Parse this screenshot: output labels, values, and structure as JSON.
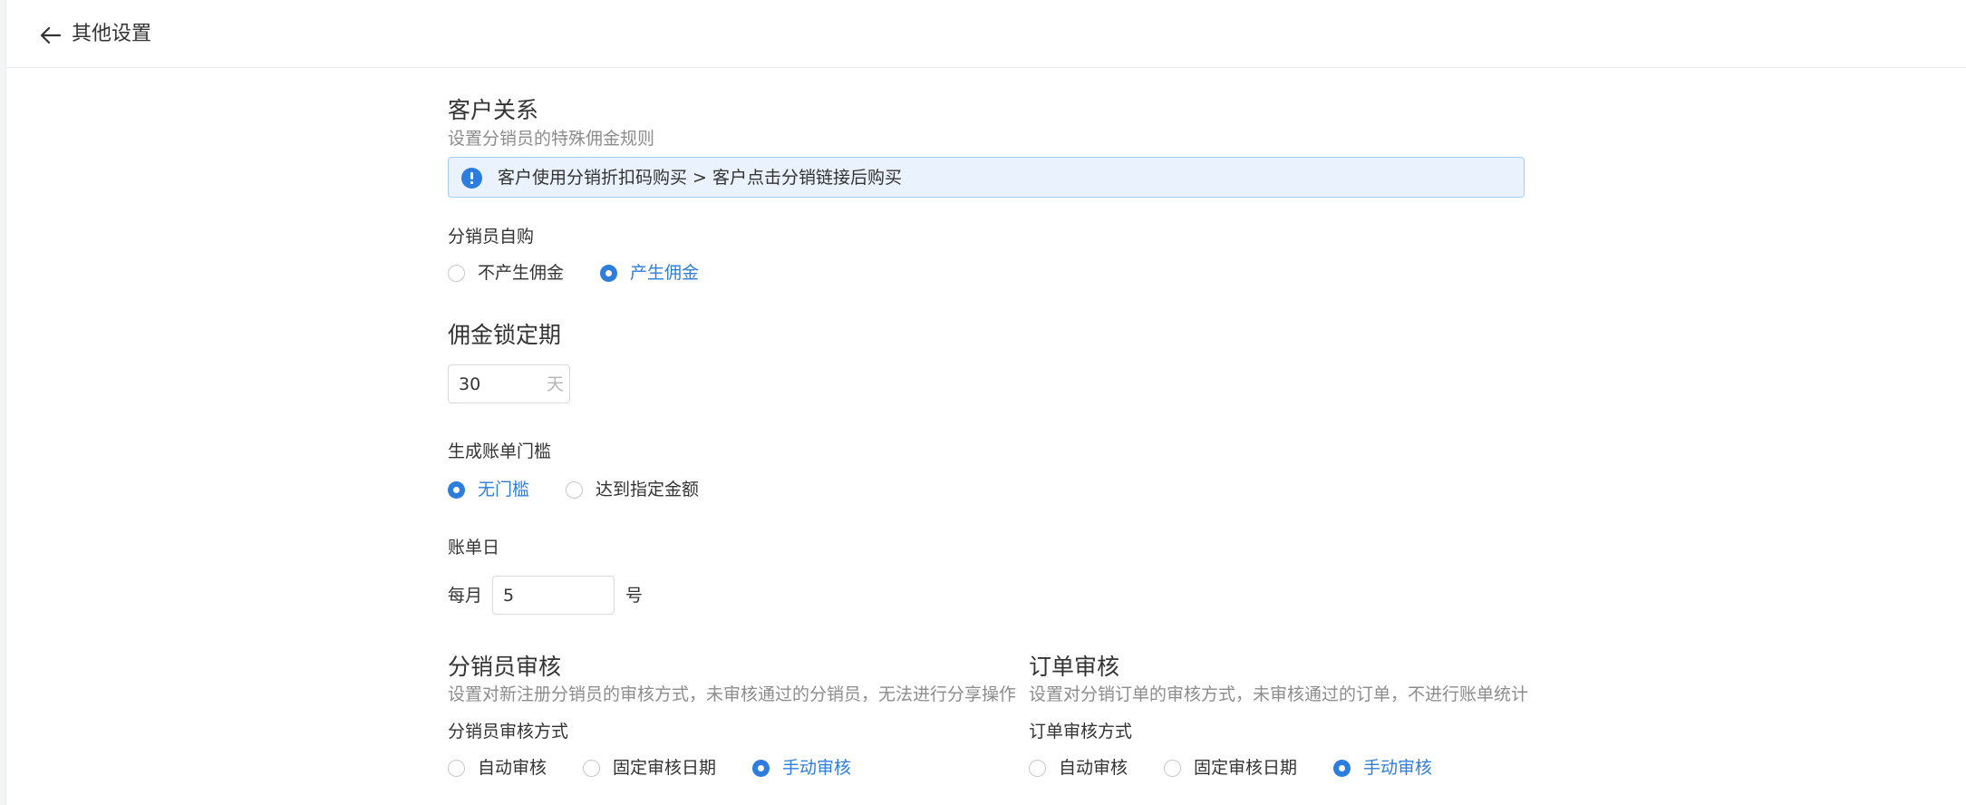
{
  "header": {
    "title": "其他设置"
  },
  "customer": {
    "title": "客户关系",
    "desc": "设置分销员的特殊佣金规则",
    "notice": "客户使用分销折扣码购买 > 客户点击分销链接后购买"
  },
  "self_purchase": {
    "label": "分销员自购",
    "options": [
      "不产生佣金",
      "产生佣金"
    ],
    "selected": "产生佣金"
  },
  "lock_period": {
    "title": "佣金锁定期",
    "value": "30",
    "unit": "天"
  },
  "bill_threshold": {
    "label": "生成账单门槛",
    "options": [
      "无门槛",
      "达到指定金额"
    ],
    "selected": "无门槛"
  },
  "bill_day": {
    "label": "账单日",
    "prefix": "每月",
    "value": "5",
    "suffix": "号"
  },
  "distributor_review": {
    "title": "分销员审核",
    "desc": "设置对新注册分销员的审核方式，未审核通过的分销员，无法进行分享操作",
    "label": "分销员审核方式",
    "options": [
      "自动审核",
      "固定审核日期",
      "手动审核"
    ],
    "selected": "手动审核"
  },
  "order_review": {
    "title": "订单审核",
    "desc": "设置对分销订单的审核方式，未审核通过的订单，不进行账单统计",
    "label": "订单审核方式",
    "options": [
      "自动审核",
      "固定审核日期",
      "手动审核"
    ],
    "selected": "手动审核"
  },
  "colors": {
    "accent": "#2d7ddc",
    "notice_bg": "#eaf3fd",
    "notice_border": "#a6cdf5"
  }
}
